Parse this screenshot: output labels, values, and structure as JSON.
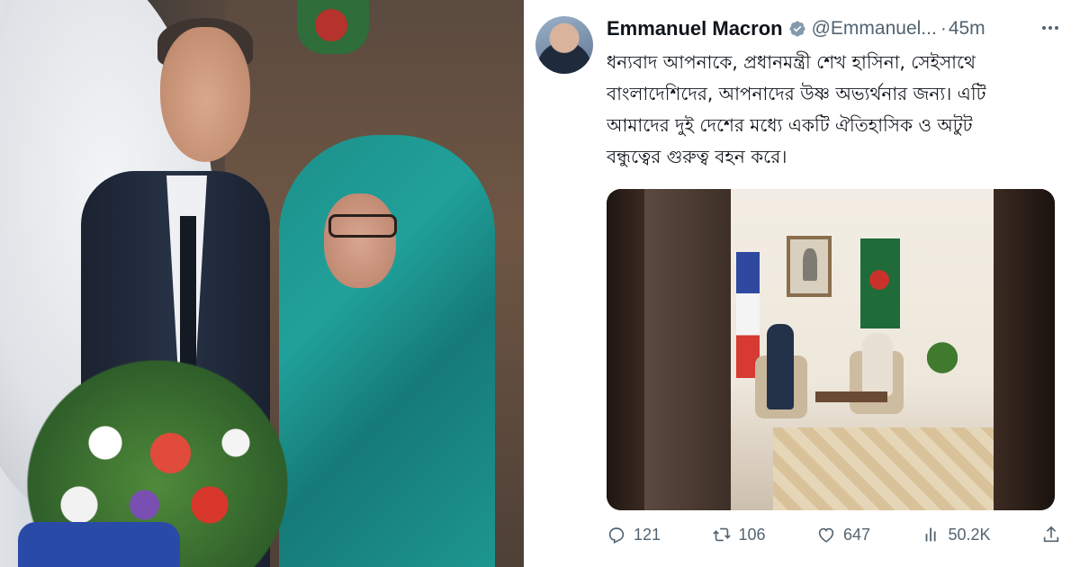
{
  "tweet": {
    "author_name": "Emmanuel Macron",
    "handle": "@Emmanuel...",
    "separator": "·",
    "time": "45m",
    "text_lines": [
      "ধন্যবাদ আপনাকে, প্রধানমন্ত্রী শেখ হাসিনা, সেইসাথে",
      "বাংলাদেশিদের, আপনাদের উষ্ণ অভ্যর্থনার জন্য। এটি",
      "আমাদের দুই দেশের মধ্যে একটি ঐতিহাসিক ও অটুট",
      "বন্ধুত্বের গুরুত্ব বহন করে।"
    ],
    "actions": {
      "replies": "121",
      "reposts": "106",
      "likes": "647",
      "views": "50.2K"
    }
  },
  "icons": {
    "verified": "verified-badge-icon",
    "more": "more-options-icon",
    "reply": "reply-icon",
    "repost": "repost-icon",
    "like": "heart-icon",
    "views": "views-bar-chart-icon",
    "share": "share-icon"
  },
  "colors": {
    "text_primary": "#0f1419",
    "text_secondary": "#536471",
    "verified_badge": "#829aab"
  }
}
